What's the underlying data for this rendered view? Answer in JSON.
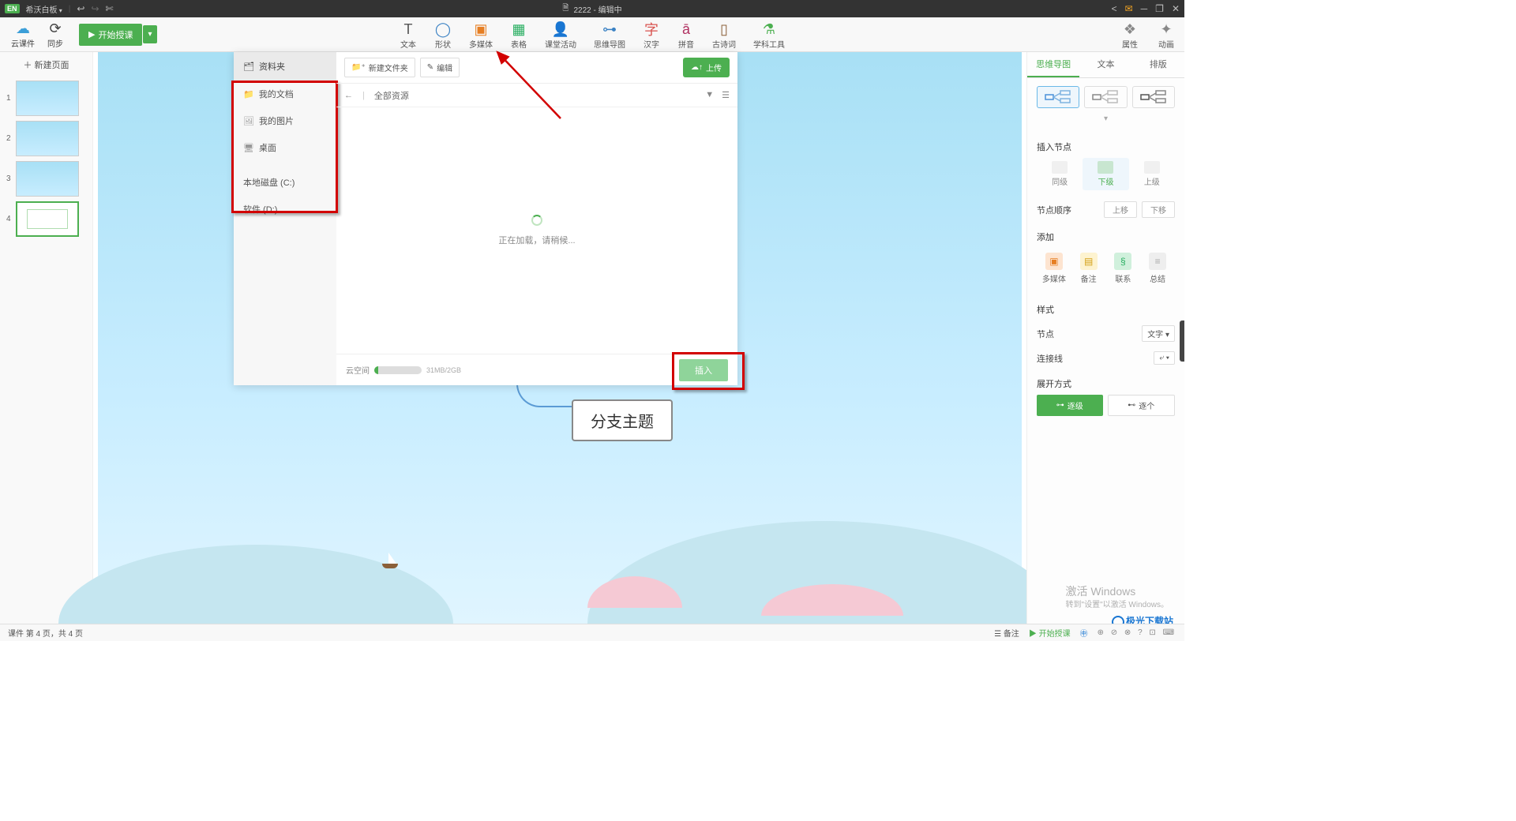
{
  "titlebar": {
    "badge": "EN",
    "app_name": "希沃白板",
    "doc_icon": "🗎",
    "doc_title": "2222 - 编辑中"
  },
  "toolbar": {
    "cloud_course": "云课件",
    "sync": "同步",
    "start_class": "开始授课",
    "center": [
      {
        "id": "text",
        "label": "文本",
        "color": "#555",
        "glyph": "T"
      },
      {
        "id": "shape",
        "label": "形状",
        "color": "#3b82c4",
        "glyph": "◯"
      },
      {
        "id": "media",
        "label": "多媒体",
        "color": "#e67e22",
        "glyph": "▣"
      },
      {
        "id": "table",
        "label": "表格",
        "color": "#27ae60",
        "glyph": "▦"
      },
      {
        "id": "activity",
        "label": "课堂活动",
        "color": "#d9534f",
        "glyph": "👤"
      },
      {
        "id": "mindmap",
        "label": "思维导图",
        "color": "#3b82c4",
        "glyph": "⊶"
      },
      {
        "id": "hanzi",
        "label": "汉字",
        "color": "#d9534f",
        "glyph": "字"
      },
      {
        "id": "pinyin",
        "label": "拼音",
        "color": "#b03060",
        "glyph": "ā"
      },
      {
        "id": "poem",
        "label": "古诗词",
        "color": "#8b6039",
        "glyph": "▯"
      },
      {
        "id": "subject",
        "label": "学科工具",
        "color": "#4caf50",
        "glyph": "⚗"
      }
    ],
    "right": [
      {
        "id": "properties",
        "label": "属性",
        "glyph": "❖"
      },
      {
        "id": "animation",
        "label": "动画",
        "glyph": "✦"
      }
    ]
  },
  "leftpanel": {
    "new_page": "＋ 新建页面",
    "thumbs": [
      {
        "n": "1"
      },
      {
        "n": "2"
      },
      {
        "n": "3"
      },
      {
        "n": "4",
        "active": true
      }
    ]
  },
  "canvas": {
    "branch_topic": "分支主题"
  },
  "modal": {
    "sidebar_header": "资料夹",
    "sidebar_items": [
      {
        "icon": "📁",
        "label": "我的文档"
      },
      {
        "icon": "🖼",
        "label": "我的图片"
      },
      {
        "icon": "🖥",
        "label": "桌面"
      }
    ],
    "sidebar_drives": [
      {
        "label": "本地磁盘 (C:)"
      },
      {
        "label": "软件 (D:)"
      }
    ],
    "new_folder": "新建文件夹",
    "edit": "编辑",
    "upload": "上传",
    "breadcrumb": "全部资源",
    "loading": "正在加载，请稍候...",
    "cloud_space": "云空间",
    "storage": "31MB/2GB",
    "insert": "插入"
  },
  "rightpanel": {
    "tabs": [
      "思维导图",
      "文本",
      "排版"
    ],
    "insert_node": "插入节点",
    "node_btns": [
      "同级",
      "下级",
      "上级"
    ],
    "node_order": "节点顺序",
    "order_btns": [
      "上移",
      "下移"
    ],
    "add": "添加",
    "add_items": [
      "多媒体",
      "备注",
      "联系",
      "总结"
    ],
    "style": "样式",
    "node_label": "节点",
    "node_dd": "文字 ▾",
    "connector_label": "连接线",
    "connector_dd": "⤶ ▾",
    "expand": "展开方式",
    "expand_btns": [
      "逐级",
      "逐个"
    ]
  },
  "statusbar": {
    "page_info": "课件 第 4 页，共 4 页",
    "notes": "备注",
    "start_class": "开始授课"
  },
  "watermark": {
    "title": "激活 Windows",
    "sub": "转到\"设置\"以激活 Windows。",
    "logo": "极光下载站"
  }
}
